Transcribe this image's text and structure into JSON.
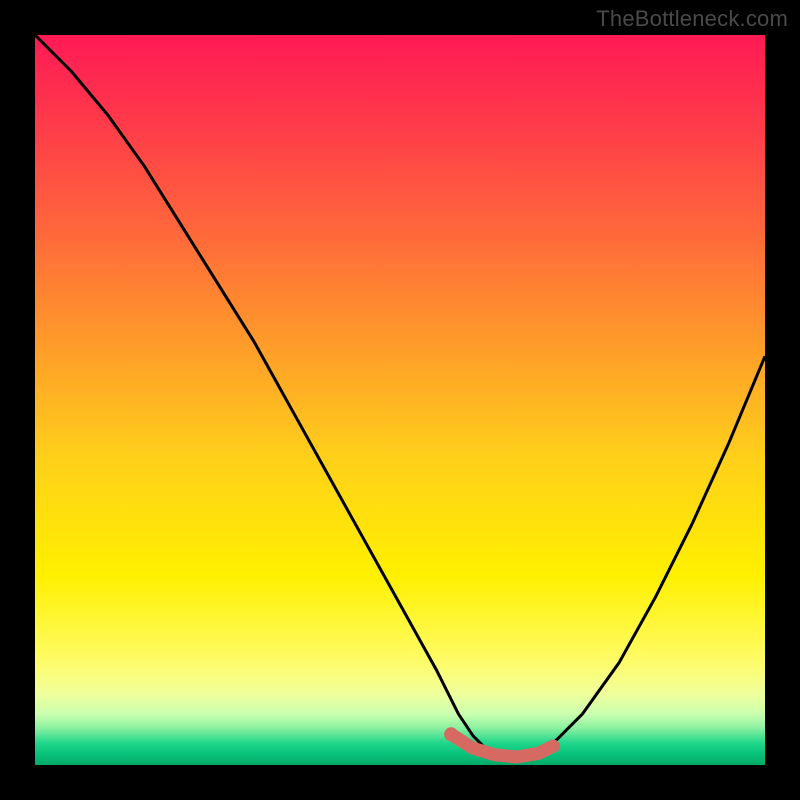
{
  "watermark": "TheBottleneck.com",
  "chart_data": {
    "type": "line",
    "title": "",
    "xlabel": "",
    "ylabel": "",
    "xlim": [
      0,
      100
    ],
    "ylim": [
      0,
      100
    ],
    "series": [
      {
        "name": "curve",
        "x": [
          0,
          5,
          10,
          15,
          20,
          25,
          30,
          35,
          40,
          45,
          50,
          55,
          58,
          60,
          62,
          65,
          68,
          70,
          75,
          80,
          85,
          90,
          95,
          100
        ],
        "values": [
          100,
          95,
          89,
          82,
          74,
          66,
          58,
          49,
          40,
          31,
          22,
          13,
          7,
          4,
          2,
          1,
          1,
          2,
          7,
          14,
          23,
          33,
          44,
          56
        ]
      },
      {
        "name": "highlight",
        "x": [
          57,
          60,
          63,
          66,
          69,
          71
        ],
        "values": [
          4.2,
          2.3,
          1.4,
          1.1,
          1.6,
          2.6
        ]
      }
    ],
    "annotations": []
  }
}
